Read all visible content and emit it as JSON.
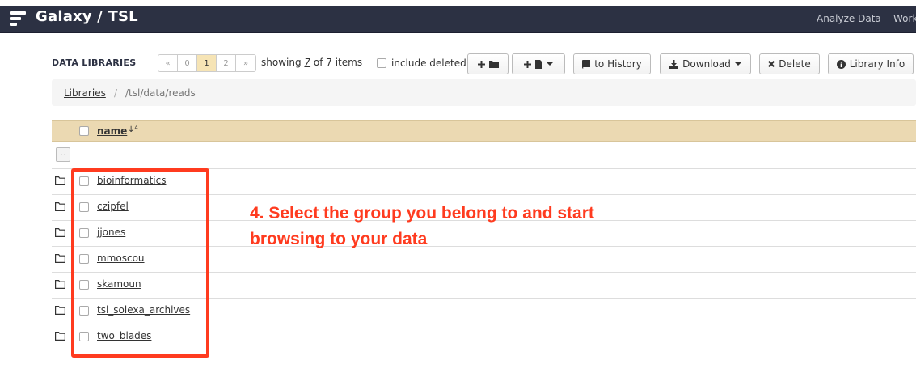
{
  "navbar": {
    "brand": "Galaxy / TSL",
    "links": [
      "Analyze Data",
      "Work"
    ]
  },
  "toolbar": {
    "title": "DATA LIBRARIES",
    "pager": [
      "«",
      "0",
      "1",
      "2",
      "»"
    ],
    "pager_active": "1",
    "showing_prefix": "showing",
    "showing_count": "7",
    "showing_suffix": "of 7 items",
    "include_deleted": "include deleted",
    "to_history": "to History",
    "download": "Download",
    "delete": "Delete",
    "library_info": "Library Info"
  },
  "breadcrumb": {
    "root": "Libraries",
    "separator": "/",
    "current": "/tsl/data/reads"
  },
  "table": {
    "header": "name",
    "sort_glyph": "↓ᴬ",
    "up_label": "..",
    "rows": [
      "bioinformatics",
      "czipfel",
      "jjones",
      "mmoscou",
      "skamoun",
      "tsl_solexa_archives",
      "two_blades"
    ]
  },
  "annotation": {
    "line1": "4. Select the group you belong to and start",
    "line2": "browsing to your data",
    "color": "#ff3b1f"
  },
  "colors": {
    "navbar": "#2c3143",
    "table_header": "#ebd9b2",
    "pager_active": "#f6e4b5"
  }
}
